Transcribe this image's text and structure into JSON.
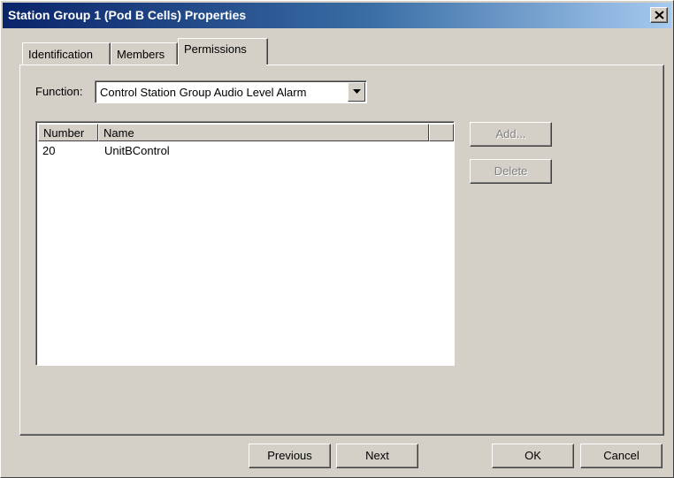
{
  "window": {
    "title": "Station Group 1 (Pod B Cells) Properties"
  },
  "tabs": [
    {
      "label": "Identification",
      "active": false
    },
    {
      "label": "Members",
      "active": false
    },
    {
      "label": "Permissions",
      "active": true
    }
  ],
  "function": {
    "label": "Function:",
    "selected": "Control Station Group Audio Level Alarm"
  },
  "list": {
    "columns": [
      "Number",
      "Name"
    ],
    "rows": [
      {
        "number": "20",
        "name": "UnitBControl"
      }
    ]
  },
  "side_buttons": {
    "add_label": "Add...",
    "delete_label": "Delete"
  },
  "footer": {
    "previous_label": "Previous",
    "next_label": "Next",
    "ok_label": "OK",
    "cancel_label": "Cancel"
  },
  "colors": {
    "face": "#d4d0c8",
    "titlebar_start": "#0a246a",
    "titlebar_end": "#a6caf0",
    "disabled_text": "#808080"
  },
  "icons": {
    "close": "close-icon",
    "dropdown": "chevron-down-icon"
  }
}
